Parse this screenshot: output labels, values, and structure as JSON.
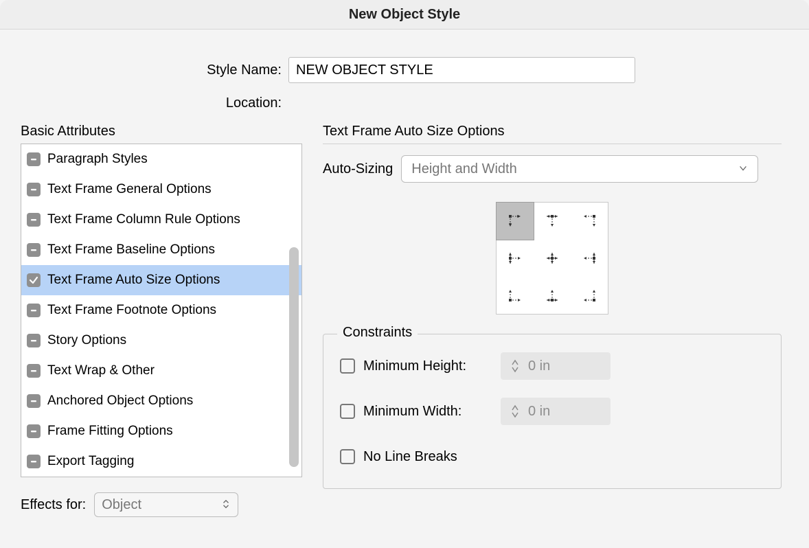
{
  "title": "New Object Style",
  "style_name_label": "Style Name:",
  "style_name_value": "NEW OBJECT STYLE",
  "location_label": "Location:",
  "basic_attributes_heading": "Basic Attributes",
  "attributes": [
    {
      "label": "Paragraph Styles",
      "state": "dash",
      "selected": false
    },
    {
      "label": "Text Frame General Options",
      "state": "dash",
      "selected": false
    },
    {
      "label": "Text Frame Column Rule Options",
      "state": "dash",
      "selected": false
    },
    {
      "label": "Text Frame Baseline Options",
      "state": "dash",
      "selected": false
    },
    {
      "label": "Text Frame Auto Size Options",
      "state": "check",
      "selected": true
    },
    {
      "label": "Text Frame Footnote Options",
      "state": "dash",
      "selected": false
    },
    {
      "label": "Story Options",
      "state": "dash",
      "selected": false
    },
    {
      "label": "Text Wrap & Other",
      "state": "dash",
      "selected": false
    },
    {
      "label": "Anchored Object Options",
      "state": "dash",
      "selected": false
    },
    {
      "label": "Frame Fitting Options",
      "state": "dash",
      "selected": false
    },
    {
      "label": "Export Tagging",
      "state": "dash",
      "selected": false
    }
  ],
  "effects_for_label": "Effects for:",
  "effects_for_value": "Object",
  "right": {
    "heading": "Text Frame Auto Size Options",
    "autosizing_label": "Auto-Sizing",
    "autosizing_value": "Height and Width",
    "constraints": {
      "legend": "Constraints",
      "min_height_label": "Minimum Height:",
      "min_height_value": "0 in",
      "min_width_label": "Minimum Width:",
      "min_width_value": "0 in",
      "no_line_breaks_label": "No Line Breaks"
    }
  }
}
